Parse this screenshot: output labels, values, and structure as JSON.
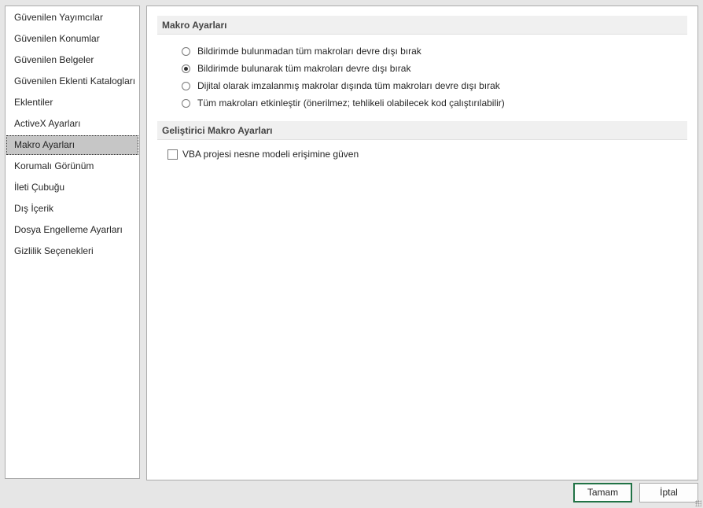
{
  "sidebar": {
    "items": [
      {
        "label": "Güvenilen Yayımcılar",
        "selected": false
      },
      {
        "label": "Güvenilen Konumlar",
        "selected": false
      },
      {
        "label": "Güvenilen Belgeler",
        "selected": false
      },
      {
        "label": "Güvenilen Eklenti Katalogları",
        "selected": false
      },
      {
        "label": "Eklentiler",
        "selected": false
      },
      {
        "label": "ActiveX Ayarları",
        "selected": false
      },
      {
        "label": "Makro Ayarları",
        "selected": true
      },
      {
        "label": "Korumalı Görünüm",
        "selected": false
      },
      {
        "label": "İleti Çubuğu",
        "selected": false
      },
      {
        "label": "Dış İçerik",
        "selected": false
      },
      {
        "label": "Dosya Engelleme Ayarları",
        "selected": false
      },
      {
        "label": "Gizlilik Seçenekleri",
        "selected": false
      }
    ]
  },
  "macro_settings": {
    "header": "Makro Ayarları",
    "options": [
      {
        "label": "Bildirimde bulunmadan tüm makroları devre dışı bırak",
        "checked": false
      },
      {
        "label": "Bildirimde bulunarak tüm makroları devre dışı bırak",
        "checked": true
      },
      {
        "label": "Dijital olarak imzalanmış makrolar dışında tüm makroları devre dışı bırak",
        "checked": false
      },
      {
        "label": "Tüm makroları etkinleştir (önerilmez; tehlikeli olabilecek kod çalıştırılabilir)",
        "checked": false
      }
    ]
  },
  "developer_settings": {
    "header": "Geliştirici Makro Ayarları",
    "vba_trust": {
      "label": "VBA projesi nesne modeli erişimine güven",
      "checked": false
    }
  },
  "footer": {
    "ok_label": "Tamam",
    "cancel_label": "İptal"
  }
}
